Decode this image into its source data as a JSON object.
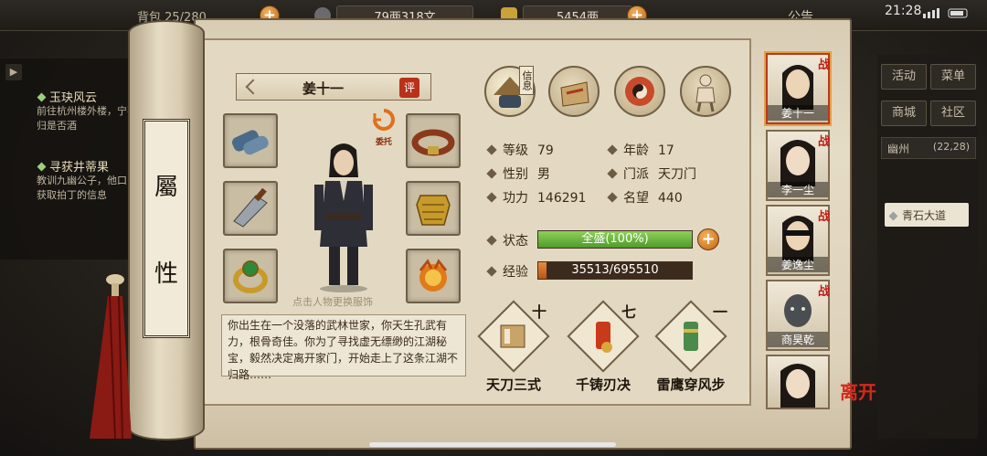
{
  "topbar": {
    "storage": "背包 25/280",
    "money_1": "79两318文",
    "money_2": "5454两",
    "notice": "公告",
    "time": "21:28"
  },
  "quests": [
    {
      "title": "玉玦风云",
      "text": "前往杭州楼外楼，宁不归是否酒"
    },
    {
      "title": "寻获井蒂果",
      "text": "教训九幽公子，他口中获取拍丁的信息"
    }
  ],
  "right_menu": {
    "activity": "活动",
    "menu": "菜单",
    "shop": "商城",
    "community": "社区",
    "location_name": "幽州",
    "location_coords": "(22,28)",
    "road": "青石大道"
  },
  "scroll": {
    "label_top": "屬",
    "label_bottom": "性"
  },
  "character": {
    "name": "姜十一",
    "rate": "评",
    "delegate": "委托",
    "change_outfit": "点击人物更换服饰",
    "bio": "你出生在一个没落的武林世家，你天生孔武有力，根骨奇佳。你为了寻找虚无缥缈的江湖秘宝，毅然决定离开家门，开始走上了这条江湖不归路……"
  },
  "tabs": {
    "info": "信息"
  },
  "stats": {
    "level_label": "等级",
    "level": "79",
    "age_label": "年龄",
    "age": "17",
    "gender_label": "性别",
    "gender": "男",
    "sect_label": "门派",
    "sect": "天刀门",
    "power_label": "功力",
    "power": "146291",
    "fame_label": "名望",
    "fame": "440",
    "status_label": "状态",
    "status": "全盛(100%)",
    "status_fraction": 1.0,
    "exp_label": "经验",
    "exp": "35513/695510",
    "exp_fraction": 0.051
  },
  "skills": [
    {
      "name": "天刀三式",
      "level": "十"
    },
    {
      "name": "千铸刃决",
      "level": "七"
    },
    {
      "name": "雷鹰穿风步",
      "level": "一"
    }
  ],
  "team": [
    {
      "name": "姜十一",
      "tag": "战"
    },
    {
      "name": "李一尘",
      "tag": "战"
    },
    {
      "name": "姜逸尘",
      "tag": "战"
    },
    {
      "name": "商昊乾",
      "tag": "战"
    },
    {
      "name": "",
      "tag": ""
    }
  ],
  "leave": "离开",
  "colors": {
    "accent_red": "#c01a12",
    "status_green": "#4e9a2a",
    "exp_orange": "#d06a22",
    "parchment": "#e3d9c2"
  }
}
